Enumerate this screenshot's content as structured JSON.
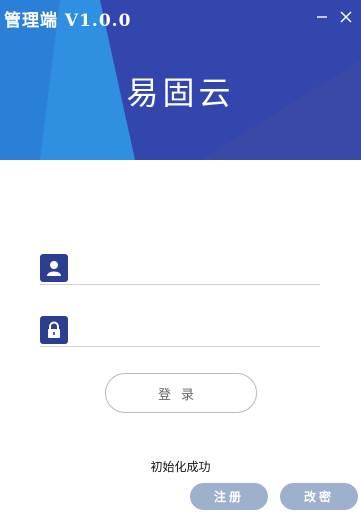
{
  "window": {
    "title": "管理端 V1.0.0",
    "minimize_icon": "minimize-icon",
    "close_icon": "close-icon"
  },
  "header": {
    "app_name": "易固云"
  },
  "form": {
    "username": {
      "icon": "user-icon",
      "value": "",
      "placeholder": ""
    },
    "password": {
      "icon": "lock-icon",
      "value": "",
      "placeholder": ""
    },
    "login_label": "登录"
  },
  "status_text": "初始化成功",
  "footer": {
    "register_label": "注册",
    "change_password_label": "改密"
  },
  "colors": {
    "header_dark": "#2b3fa8",
    "header_light": "#2f8fe0",
    "icon_box": "#2c3e8f",
    "pill_button": "#9db0cc"
  }
}
